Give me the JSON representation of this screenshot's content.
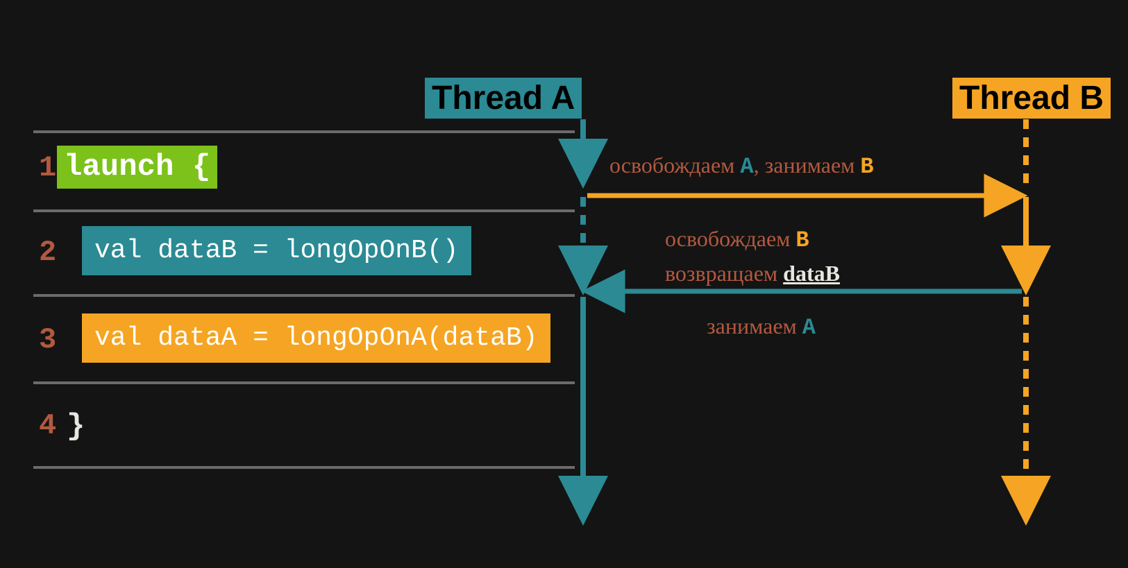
{
  "threads": {
    "a": "Thread A",
    "b": "Thread B"
  },
  "code": {
    "line1_num": "1",
    "line1_text": "launch {",
    "line2_num": "2",
    "line2_text": "val dataB = longOpOnB()",
    "line3_num": "3",
    "line3_text": "val dataA = longOpOnA(dataB)",
    "line4_num": "4",
    "line4_brace": "}"
  },
  "annotations": {
    "release_a_take_b_prefix": "освобождаем ",
    "release_a_take_b_mid": ", занимаем ",
    "release_b_prefix": "освобождаем ",
    "return_data_prefix": "возвращаем ",
    "data_key": "dataB",
    "take_a_prefix": "занимаем ",
    "A": "A",
    "B": "B"
  },
  "colors": {
    "teal": "#2b8a94",
    "orange": "#f5a523",
    "green": "#7cc21a",
    "brown": "#b3593f",
    "bg": "#141414"
  }
}
